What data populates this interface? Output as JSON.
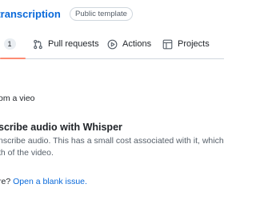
{
  "repo": {
    "name": "-transcription",
    "badge": "Public template"
  },
  "tabs": [
    {
      "label": "s",
      "count": "1",
      "icon": "issues-icon"
    },
    {
      "label": "Pull requests",
      "icon": "pull-request-icon"
    },
    {
      "label": "Actions",
      "icon": "play-icon"
    },
    {
      "label": "Projects",
      "icon": "table-icon"
    }
  ],
  "template_description": "om a vieo",
  "template_item": {
    "title": "scribe audio with Whisper",
    "body_line1": "nscribe audio. This has a small cost associated with it, which",
    "body_line2": "th of the video."
  },
  "footer": {
    "prefix": "re?",
    "link": "Open a blank issue."
  },
  "colors": {
    "link": "#0969da",
    "active_tab_underline": "#fd8c73",
    "border": "#d0d7de"
  }
}
